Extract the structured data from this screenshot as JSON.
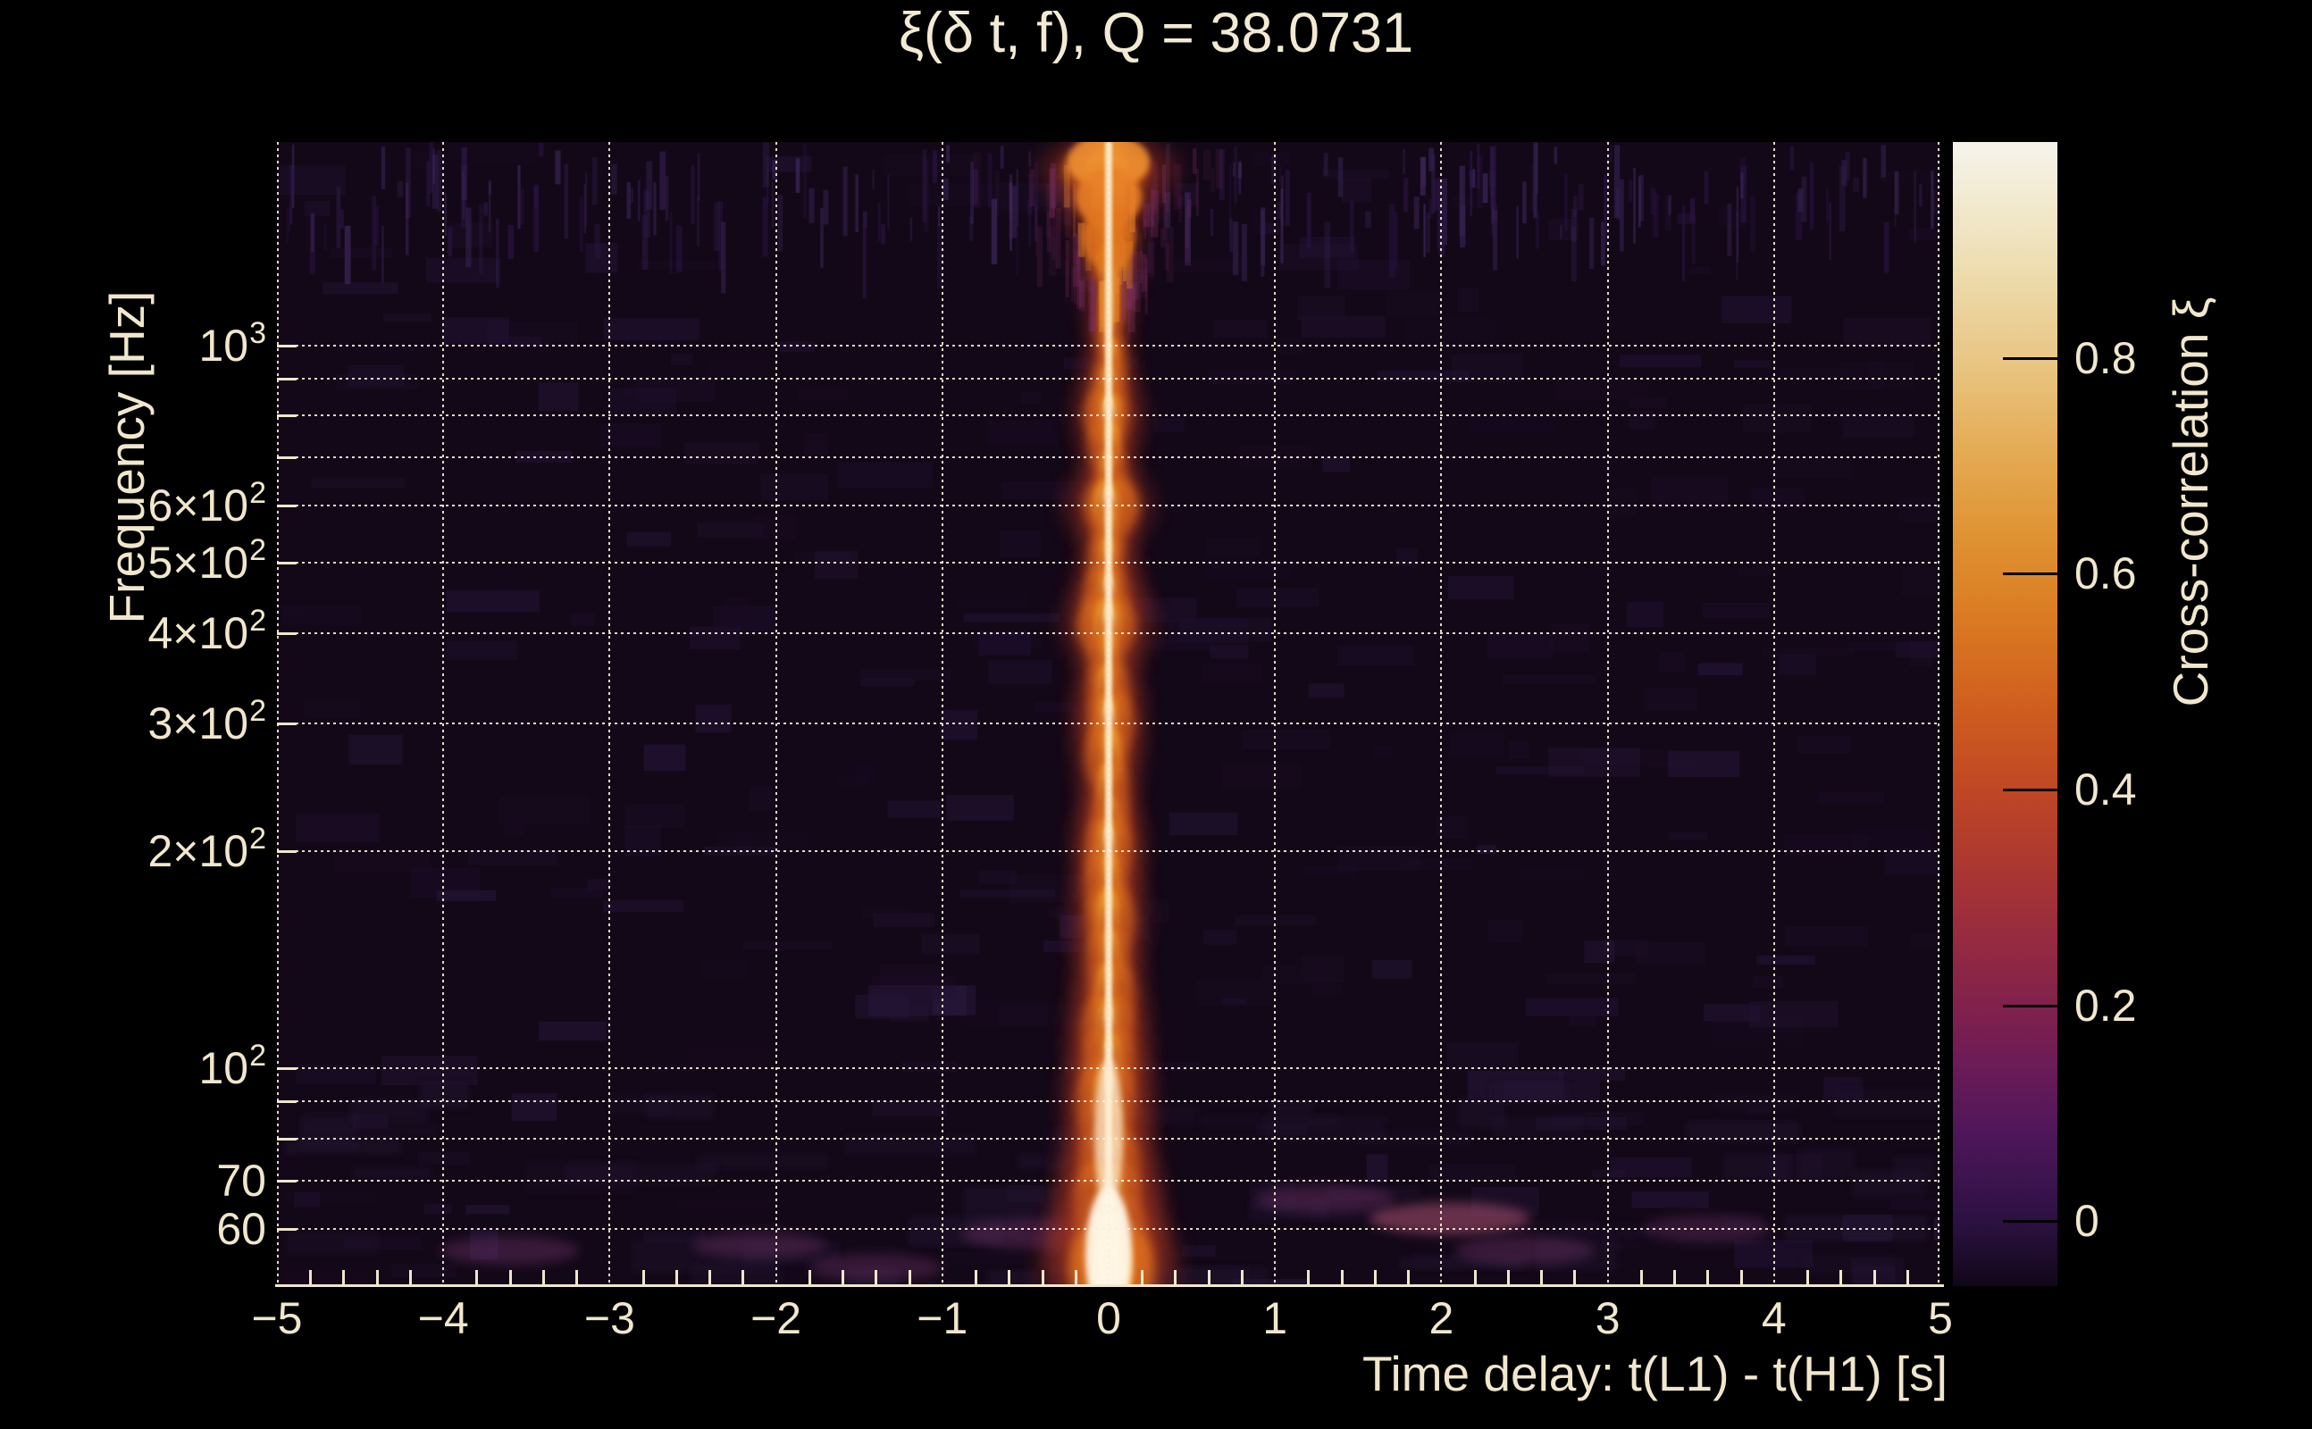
{
  "figure": {
    "background_color": "#000000",
    "text_color": "#f0e7cc"
  },
  "chart_data": {
    "type": "heatmap",
    "title": "ξ(δ t, f), Q = 38.0731",
    "q_value": 38.0731,
    "xlabel": "Time delay: t(L1) - t(H1) [s]",
    "ylabel": "Frequency [Hz]",
    "xlim": [
      -5,
      5
    ],
    "ylim_hz": [
      50,
      1910
    ],
    "y_scale": "log",
    "grid": true,
    "x_ticks": [
      -5,
      -4,
      -3,
      -2,
      -1,
      0,
      1,
      2,
      3,
      4,
      5
    ],
    "x_tick_labels": [
      "−5",
      "−4",
      "−3",
      "−2",
      "−1",
      "0",
      "1",
      "2",
      "3",
      "4",
      "5"
    ],
    "x_minor_tick_step": 0.2,
    "y_gridline_frequencies": [
      60,
      70,
      80,
      90,
      100,
      200,
      300,
      400,
      500,
      600,
      700,
      800,
      900,
      1000
    ],
    "y_tick_labels": [
      {
        "f": 60,
        "text": "60",
        "sup": ""
      },
      {
        "f": 70,
        "text": "70",
        "sup": ""
      },
      {
        "f": 100,
        "text": "10",
        "sup": "2"
      },
      {
        "f": 200,
        "text": "2×10",
        "sup": "2"
      },
      {
        "f": 300,
        "text": "3×10",
        "sup": "2"
      },
      {
        "f": 400,
        "text": "4×10",
        "sup": "2"
      },
      {
        "f": 500,
        "text": "5×10",
        "sup": "2"
      },
      {
        "f": 600,
        "text": "6×10",
        "sup": "2"
      },
      {
        "f": 1000,
        "text": "10",
        "sup": "3"
      }
    ],
    "colorbar": {
      "label": "Cross-correlation ξ",
      "range": [
        -0.06,
        1.0
      ],
      "ticks": [
        0,
        0.2,
        0.4,
        0.6,
        0.8
      ],
      "tick_labels": [
        "0",
        "0.2",
        "0.4",
        "0.6",
        "0.8"
      ],
      "colormap_stops": [
        [
          1.0,
          "#f6f3ec"
        ],
        [
          0.95,
          "#f2ebd2"
        ],
        [
          0.88,
          "#eddcae"
        ],
        [
          0.8,
          "#e9c786"
        ],
        [
          0.72,
          "#e5ad58"
        ],
        [
          0.64,
          "#e09434"
        ],
        [
          0.56,
          "#da7b22"
        ],
        [
          0.48,
          "#d05f1f"
        ],
        [
          0.4,
          "#c04724"
        ],
        [
          0.32,
          "#a93533"
        ],
        [
          0.24,
          "#8f2745"
        ],
        [
          0.16,
          "#721d55"
        ],
        [
          0.08,
          "#4e165a"
        ],
        [
          0.0,
          "#2c1142"
        ],
        [
          -0.06,
          "#120719"
        ]
      ]
    },
    "ridge": {
      "center_time_s": 0.0,
      "description": "Bright vertical cross-correlation ridge at zero time delay spanning all frequencies; beaded structure, flared fan at top (>1100 Hz), widest and brightest near 50-70 Hz",
      "profile_f_halfwidth_brightness": [
        [
          1900,
          0.14,
          0.7
        ],
        [
          1750,
          0.26,
          0.8
        ],
        [
          1600,
          0.2,
          0.75
        ],
        [
          1450,
          0.13,
          0.75
        ],
        [
          1300,
          0.12,
          0.8
        ],
        [
          1150,
          0.09,
          0.8
        ],
        [
          1050,
          0.07,
          0.85
        ],
        [
          950,
          0.08,
          0.85
        ],
        [
          870,
          0.1,
          0.9
        ],
        [
          800,
          0.13,
          0.95
        ],
        [
          730,
          0.1,
          0.9
        ],
        [
          660,
          0.09,
          0.85
        ],
        [
          600,
          0.16,
          1.0
        ],
        [
          550,
          0.09,
          0.85
        ],
        [
          500,
          0.1,
          0.9
        ],
        [
          450,
          0.13,
          0.95
        ],
        [
          410,
          0.17,
          0.95
        ],
        [
          370,
          0.1,
          0.85
        ],
        [
          330,
          0.12,
          0.9
        ],
        [
          300,
          0.13,
          0.95
        ],
        [
          270,
          0.12,
          0.9
        ],
        [
          240,
          0.1,
          0.85
        ],
        [
          215,
          0.11,
          0.9
        ],
        [
          200,
          0.13,
          0.95
        ],
        [
          180,
          0.12,
          0.9
        ],
        [
          160,
          0.14,
          0.9
        ],
        [
          140,
          0.12,
          0.9
        ],
        [
          125,
          0.13,
          0.9
        ],
        [
          112,
          0.15,
          0.95
        ],
        [
          100,
          0.15,
          0.95
        ],
        [
          90,
          0.17,
          0.95
        ],
        [
          80,
          0.15,
          0.9
        ],
        [
          72,
          0.18,
          0.95
        ],
        [
          65,
          0.2,
          1.0
        ],
        [
          58,
          0.22,
          1.0
        ],
        [
          53,
          0.26,
          1.0
        ]
      ]
    },
    "noise_features": [
      {
        "t": 2.05,
        "f": 62,
        "intensity": 0.5
      },
      {
        "t": -0.45,
        "f": 59,
        "intensity": 0.35
      },
      {
        "t": 1.3,
        "f": 66,
        "intensity": 0.3
      },
      {
        "t": -3.6,
        "f": 56,
        "intensity": 0.3
      },
      {
        "t": 2.5,
        "f": 56,
        "intensity": 0.3
      },
      {
        "t": -2.1,
        "f": 57,
        "intensity": 0.25
      },
      {
        "t": 3.6,
        "f": 60,
        "intensity": 0.2
      },
      {
        "t": -1.4,
        "f": 53,
        "intensity": 0.25
      }
    ]
  }
}
